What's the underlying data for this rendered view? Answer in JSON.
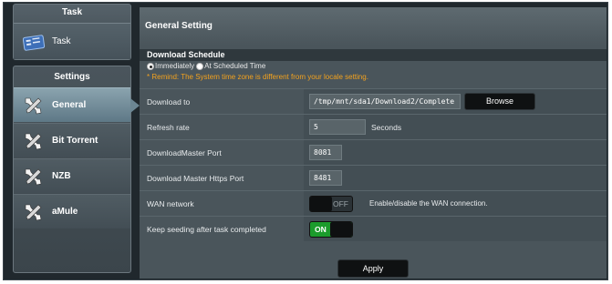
{
  "sidebar": {
    "task_header": "Task",
    "task_item": "Task",
    "settings_header": "Settings",
    "items": [
      {
        "label": "General",
        "icon": "tools-icon",
        "active": true
      },
      {
        "label": "Bit Torrent",
        "icon": "tools-icon",
        "active": false
      },
      {
        "label": "NZB",
        "icon": "tools-icon",
        "active": false
      },
      {
        "label": "aMule",
        "icon": "tools-icon",
        "active": false
      }
    ]
  },
  "main": {
    "title": "General Setting",
    "section": "Download Schedule",
    "schedule": {
      "option_immediately": "Immediately",
      "option_scheduled": "At Scheduled Time",
      "selected": "Immediately"
    },
    "remind": "* Remind: The System time zone is different from your locale setting.",
    "fields": {
      "download_to": {
        "label": "Download to",
        "value": "/tmp/mnt/sda1/Download2/Complete",
        "button": "Browse"
      },
      "refresh_rate": {
        "label": "Refresh rate",
        "value": "5",
        "unit": "Seconds"
      },
      "dm_port": {
        "label": "DownloadMaster Port",
        "value": "8081"
      },
      "dm_https_port": {
        "label": "Download Master Https Port",
        "value": "8481"
      },
      "wan_network": {
        "label": "WAN network",
        "state": "OFF",
        "description": "Enable/disable the WAN connection."
      },
      "keep_seeding": {
        "label": "Keep seeding after task completed",
        "state": "ON"
      }
    },
    "apply": "Apply"
  },
  "colors": {
    "accent_orange": "#f3a21e",
    "toggle_on": "#1b9c2c",
    "active_nav": "#6c8693"
  }
}
